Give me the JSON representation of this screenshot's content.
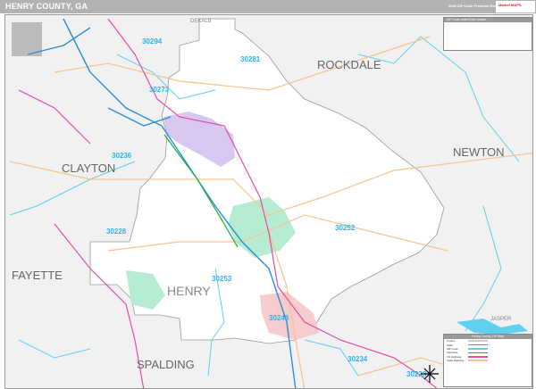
{
  "header": {
    "title": "HENRY COUNTY, GA",
    "edition": "2020 ZIP Code Premium Edition",
    "logo": "Market MAPS"
  },
  "map": {
    "county_name": "HENRY",
    "neighbors": [
      "DEKALB",
      "ROCKDALE",
      "CLAYTON",
      "NEWTON",
      "FAYETTE",
      "SPALDING",
      "JASPER"
    ],
    "zip_codes": [
      "30294",
      "30281",
      "30273",
      "30236",
      "30228",
      "30252",
      "30253",
      "30248",
      "30234",
      "30233"
    ],
    "colors": {
      "outside": "#f1f1f1",
      "county": "#ffffff",
      "water": "#5fd0f0",
      "interstate": "#2a8fd6",
      "us_highway": "#e84aa8",
      "state_highway": "#f5c490",
      "toll": "#2bb24c",
      "city_purple": "#d7c8f2",
      "city_green": "#b6ecd2",
      "city_pink": "#f6cccc"
    }
  },
  "zip_index": {
    "title": "ZIP Code Index/Grid Locator"
  },
  "legend": {
    "title": "Henry County ZIP Map",
    "items": [
      "County",
      "State",
      "ZIP Code",
      "Interstate",
      "US Highway",
      "State Highway"
    ]
  }
}
